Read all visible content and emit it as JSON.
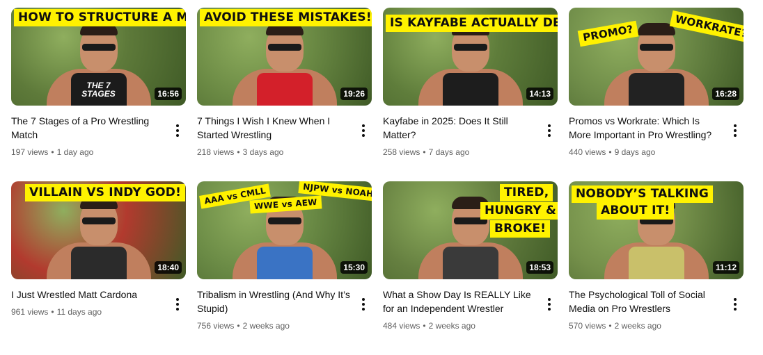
{
  "videos": [
    {
      "title": "The 7 Stages of a Pro Wrestling Match",
      "views": "197 views",
      "age": "1 day ago",
      "duration": "16:56",
      "captions": [
        "HOW TO STRUCTURE A MATCH"
      ],
      "shirt_text": "THE 7 STAGES",
      "bg": "#5e7a3a",
      "shirt": "#1b1b1b"
    },
    {
      "title": "7 Things I Wish I Knew When I Started Wrestling",
      "views": "218 views",
      "age": "3 days ago",
      "duration": "19:26",
      "captions": [
        "AVOID THESE MISTAKES!"
      ],
      "shirt_text": "",
      "bg": "#6b8a44",
      "shirt": "#d3202a"
    },
    {
      "title": "Kayfabe in 2025: Does It Still Matter?",
      "views": "258 views",
      "age": "7 days ago",
      "duration": "14:13",
      "captions": [
        "IS KAYFABE ACTUALLY DEAD?"
      ],
      "shirt_text": "",
      "bg": "#5f7d3b",
      "shirt": "#1d1d1d"
    },
    {
      "title": "Promos vs Workrate: Which Is More Important in Pro Wrestling?",
      "views": "440 views",
      "age": "9 days ago",
      "duration": "16:28",
      "captions": [
        "PROMO?",
        "WORKRATE?"
      ],
      "shirt_text": "",
      "bg": "#6e8b48",
      "shirt": "#222222"
    },
    {
      "title": "I Just Wrestled Matt Cardona",
      "views": "961 views",
      "age": "11 days ago",
      "duration": "18:40",
      "captions": [
        "VILLAIN VS INDY GOD!"
      ],
      "shirt_text": "",
      "bg": "#b23a2e",
      "shirt": "#2b2b2b"
    },
    {
      "title": "Tribalism in Wrestling (And Why It’s Stupid)",
      "views": "756 views",
      "age": "2 weeks ago",
      "duration": "15:30",
      "captions": [
        "AAA vs CMLL",
        "NJPW vs NOAH",
        "WWE vs AEW"
      ],
      "shirt_text": "",
      "bg": "#6a8a45",
      "shirt": "#3a73c4"
    },
    {
      "title": "What a Show Day Is REALLY Like for an Independent Wrestler",
      "views": "484 views",
      "age": "2 weeks ago",
      "duration": "18:53",
      "captions": [
        "TIRED,",
        "HUNGRY &",
        "BROKE!"
      ],
      "shirt_text": "",
      "bg": "#657f40",
      "shirt": "#3a3a3a"
    },
    {
      "title": "The Psychological Toll of Social Media on Pro Wrestlers",
      "views": "570 views",
      "age": "2 weeks ago",
      "duration": "11:12",
      "captions": [
        "NOBODY’S TALKING",
        "ABOUT IT!"
      ],
      "shirt_text": "",
      "bg": "#748f4a",
      "shirt": "#c9c06a"
    }
  ]
}
